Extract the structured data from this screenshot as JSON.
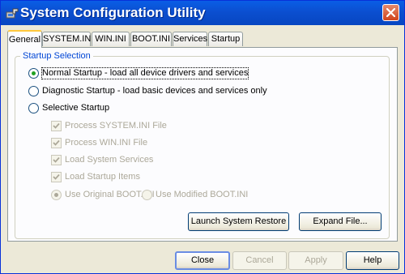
{
  "window": {
    "title": "System Configuration Utility",
    "icon": "msconfig-app-icon",
    "close_icon": "close-icon"
  },
  "tabs": [
    {
      "label": "General",
      "active": true
    },
    {
      "label": "SYSTEM.INI",
      "active": false
    },
    {
      "label": "WIN.INI",
      "active": false
    },
    {
      "label": "BOOT.INI",
      "active": false
    },
    {
      "label": "Services",
      "active": false
    },
    {
      "label": "Startup",
      "active": false
    }
  ],
  "startup_selection": {
    "legend": "Startup Selection",
    "normal": {
      "label": "Normal Startup - load all device drivers and services",
      "selected": true
    },
    "diagnostic": {
      "label": "Diagnostic Startup - load basic devices and services only",
      "selected": false
    },
    "selective": {
      "label": "Selective Startup",
      "selected": false
    },
    "options": [
      {
        "label": "Process SYSTEM.INI File",
        "checked": true,
        "enabled": false
      },
      {
        "label": "Process WIN.INI File",
        "checked": true,
        "enabled": false
      },
      {
        "label": "Load System Services",
        "checked": true,
        "enabled": false
      },
      {
        "label": "Load Startup Items",
        "checked": true,
        "enabled": false
      }
    ],
    "boot_ini": {
      "original": {
        "label": "Use Original BOOT.INI",
        "selected": true,
        "enabled": false
      },
      "modified": {
        "label": "Use Modified BOOT.INI",
        "selected": false,
        "enabled": false
      }
    },
    "launch_restore_label": "Launch System Restore",
    "expand_file_label": "Expand File..."
  },
  "footer": {
    "close_label": "Close",
    "cancel_label": "Cancel",
    "apply_label": "Apply",
    "help_label": "Help"
  },
  "colors": {
    "titlebar": "#0a5ee6",
    "face": "#ece9d8",
    "legend": "#0046d5",
    "radio_dot": "#21a121",
    "disabled_text": "#aca899"
  }
}
